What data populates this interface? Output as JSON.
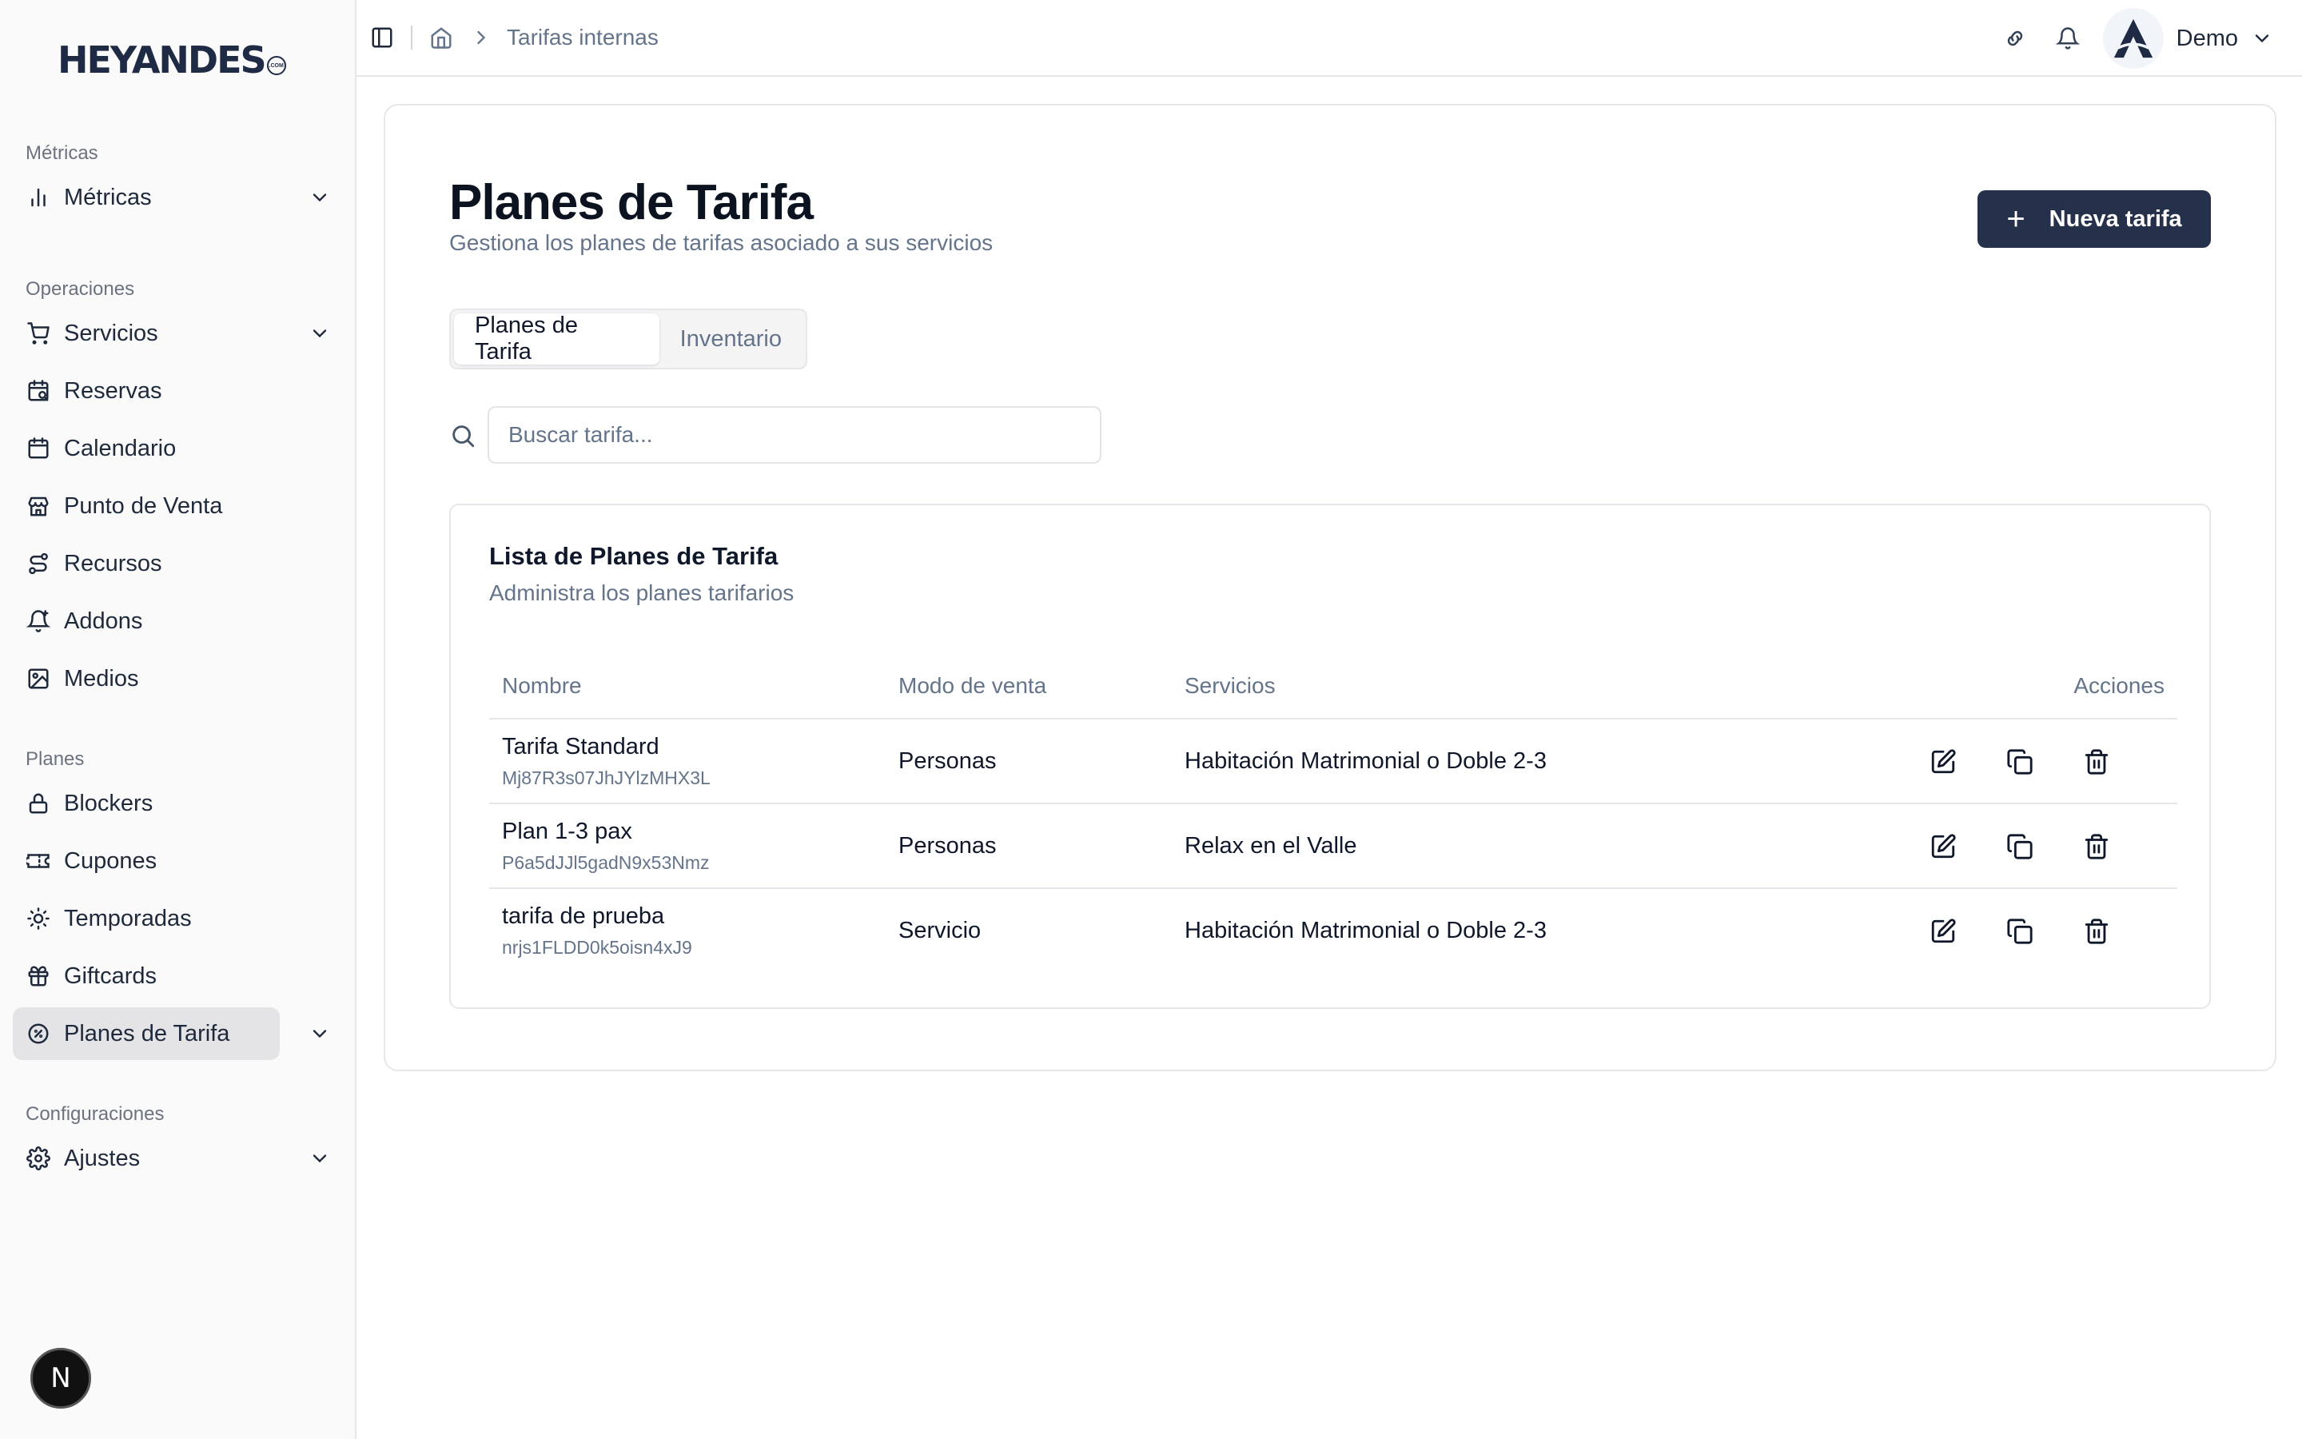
{
  "brand": {
    "logo_text": "HEYANDES",
    "logo_badge": ".COM"
  },
  "sidebar": {
    "sections": [
      {
        "label": "Métricas"
      },
      {
        "label": "Operaciones"
      },
      {
        "label": "Planes"
      },
      {
        "label": "Configuraciones"
      }
    ],
    "items": [
      {
        "label": "Métricas",
        "icon": "bar-chart-icon"
      },
      {
        "label": "Servicios",
        "icon": "cart-icon"
      },
      {
        "label": "Reservas",
        "icon": "calendar-search-icon"
      },
      {
        "label": "Calendario",
        "icon": "calendar-icon"
      },
      {
        "label": "Punto de Venta",
        "icon": "store-icon"
      },
      {
        "label": "Recursos",
        "icon": "route-icon"
      },
      {
        "label": "Addons",
        "icon": "bell-plus-icon"
      },
      {
        "label": "Medios",
        "icon": "image-icon"
      },
      {
        "label": "Blockers",
        "icon": "lock-icon"
      },
      {
        "label": "Cupones",
        "icon": "ticket-icon"
      },
      {
        "label": "Temporadas",
        "icon": "sun-icon"
      },
      {
        "label": "Giftcards",
        "icon": "gift-icon"
      },
      {
        "label": "Planes de Tarifa",
        "icon": "badge-percent-icon",
        "active": true
      },
      {
        "label": "Ajustes",
        "icon": "gear-icon"
      }
    ],
    "dev_badge": "N"
  },
  "topbar": {
    "breadcrumb": "Tarifas internas",
    "user_name": "Demo"
  },
  "page": {
    "title": "Planes de Tarifa",
    "subtitle": "Gestiona los planes de tarifas asociado a sus servicios",
    "new_button": "Nueva tarifa",
    "new_button_plus": "+",
    "tabs": [
      {
        "label": "Planes de Tarifa",
        "active": true
      },
      {
        "label": "Inventario",
        "active": false
      }
    ],
    "search_placeholder": "Buscar tarifa..."
  },
  "list": {
    "title": "Lista de Planes de Tarifa",
    "subtitle": "Administra los planes tarifarios",
    "columns": [
      "Nombre",
      "Modo de venta",
      "Servicios",
      "Acciones"
    ],
    "rows": [
      {
        "name": "Tarifa Standard",
        "id": "Mj87R3s07JhJYlzMHX3L",
        "mode": "Personas",
        "services": "Habitación Matrimonial o Doble 2-3"
      },
      {
        "name": "Plan 1-3 pax",
        "id": "P6a5dJJl5gadN9x53Nmz",
        "mode": "Personas",
        "services": "Relax en el Valle"
      },
      {
        "name": "tarifa de prueba",
        "id": "nrjs1FLDD0k5oisn4xJ9",
        "mode": "Servicio",
        "services": "Habitación Matrimonial o Doble 2-3"
      }
    ]
  },
  "colors": {
    "primary_button": "#25304a",
    "active_nav_bg": "#e4e4e7",
    "muted_text": "#64748b"
  }
}
